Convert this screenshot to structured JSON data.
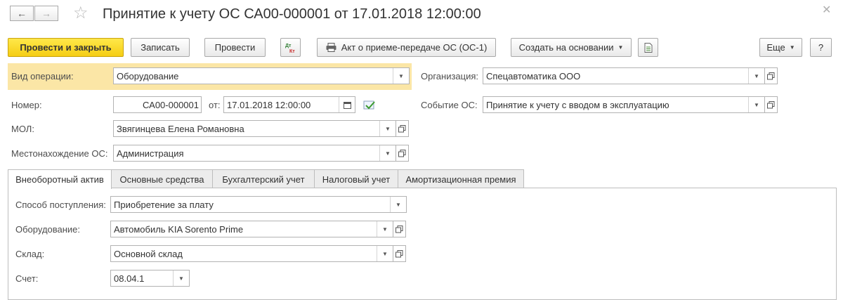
{
  "header": {
    "back_icon": "arrow-left-icon",
    "forward_icon": "arrow-right-icon",
    "favorite_icon": "star-icon",
    "title": "Принятие к учету ОС СА00-000001 от 17.01.2018 12:00:00",
    "close_icon": "close-icon"
  },
  "toolbar": {
    "post_close": "Провести и закрыть",
    "save": "Записать",
    "post": "Провести",
    "dtkt_icon": "dt-kt-icon",
    "print_act": "Акт о приеме-передаче ОС (ОС-1)",
    "create_based": "Создать на основании",
    "report_icon": "document-icon",
    "more": "Еще",
    "help": "?"
  },
  "form": {
    "operation_label": "Вид операции:",
    "operation_value": "Оборудование",
    "org_label": "Организация:",
    "org_value": "Спецавтоматика ООО",
    "number_label": "Номер:",
    "number_value": "СА00-000001",
    "from_label": "от:",
    "date_value": "17.01.2018 12:00:00",
    "event_label": "Событие ОС:",
    "event_value": "Принятие к учету с вводом в эксплуатацию",
    "mol_label": "МОЛ:",
    "mol_value": "Звягинцева Елена Романовна",
    "location_label": "Местонахождение ОС:",
    "location_value": "Администрация"
  },
  "tabs": [
    {
      "label": "Внеоборотный актив",
      "active": true
    },
    {
      "label": "Основные средства"
    },
    {
      "label": "Бухгалтерский учет"
    },
    {
      "label": "Налоговый учет"
    },
    {
      "label": "Амортизационная премия"
    }
  ],
  "tab_content": {
    "receipt_label": "Способ поступления:",
    "receipt_value": "Приобретение за плату",
    "equipment_label": "Оборудование:",
    "equipment_value": "Автомобиль KIA Sorento Prime",
    "warehouse_label": "Склад:",
    "warehouse_value": "Основной склад",
    "account_label": "Счет:",
    "account_value": "08.04.1"
  },
  "colors": {
    "primary_button": "#f5cd14",
    "highlight": "#fbe6a6"
  }
}
